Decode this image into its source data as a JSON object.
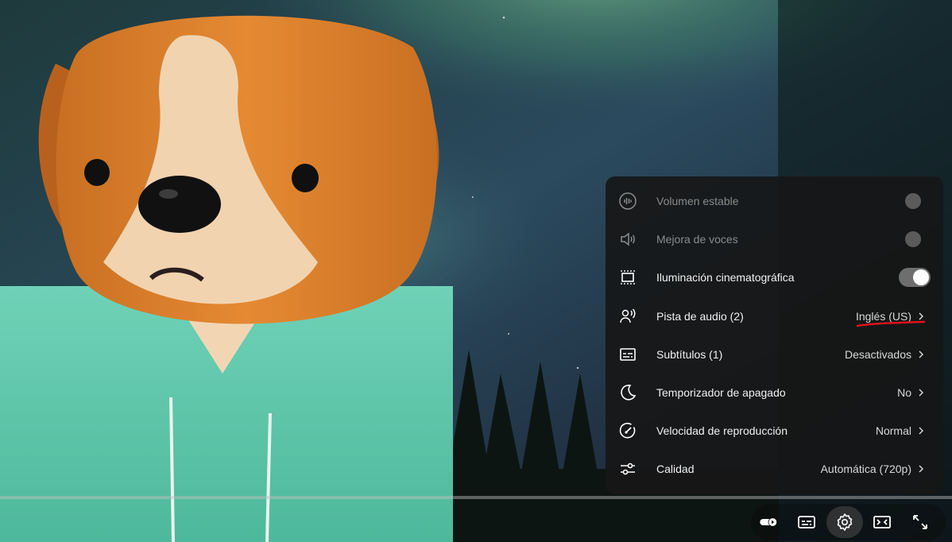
{
  "player": {
    "colors": {
      "menu_bg": "#161616",
      "text": "#f1f1f1",
      "muted": "#8a8a8a",
      "annotation": "#e0121b"
    },
    "video_scene": "cartoon dog in teal hoodie, aurora night sky with pine trees"
  },
  "settings_menu": {
    "items": [
      {
        "icon": "stable-volume-icon",
        "label": "Volumen estable",
        "control": "toggle",
        "state": "off",
        "disabled": true
      },
      {
        "icon": "voice-boost-icon",
        "label": "Mejora de voces",
        "control": "toggle",
        "state": "off",
        "disabled": true
      },
      {
        "icon": "ambient-mode-icon",
        "label": "Iluminación cinematográfica",
        "control": "toggle",
        "state": "on",
        "disabled": false
      },
      {
        "icon": "audio-track-icon",
        "label": "Pista de audio (2)",
        "value": "Inglés (US)",
        "control": "submenu"
      },
      {
        "icon": "subtitles-icon",
        "label": "Subtítulos (1)",
        "value": "Desactivados",
        "control": "submenu"
      },
      {
        "icon": "sleep-timer-icon",
        "label": "Temporizador de apagado",
        "value": "No",
        "control": "submenu"
      },
      {
        "icon": "playback-speed-icon",
        "label": "Velocidad de reproducción",
        "value": "Normal",
        "control": "submenu"
      },
      {
        "icon": "quality-icon",
        "label": "Calidad",
        "value": "Automática (720p)",
        "control": "submenu"
      }
    ]
  },
  "controls": {
    "buttons": [
      "autoplay-toggle-icon",
      "subtitles-button-icon",
      "settings-gear-icon",
      "miniplayer-icon",
      "fullscreen-icon"
    ],
    "active": "settings-gear-icon"
  }
}
